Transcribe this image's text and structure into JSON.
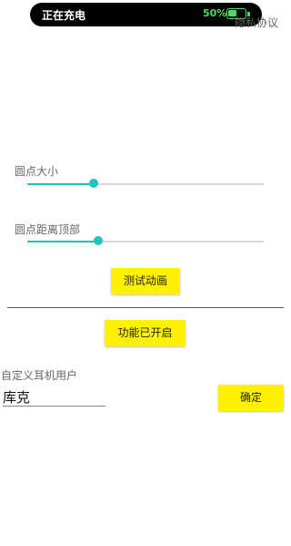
{
  "status_bar": {
    "left_text": "正在充电",
    "battery_percent": "50%",
    "battery_level": 0.5
  },
  "header": {
    "privacy_link": "隐私协议"
  },
  "dot_size": {
    "label": "圆点大小",
    "value": 0.28
  },
  "dot_distance": {
    "label": "圆点距离顶部",
    "value": 0.3
  },
  "test_button": {
    "label": "测试动画"
  },
  "feature_button": {
    "label": "功能已开启"
  },
  "custom_user": {
    "label": "自定义耳机用户",
    "value": "库克"
  },
  "confirm_button": {
    "label": "确定"
  },
  "colors": {
    "accent": "#1cc6b6",
    "button": "#fff200",
    "battery": "#4cd964"
  }
}
